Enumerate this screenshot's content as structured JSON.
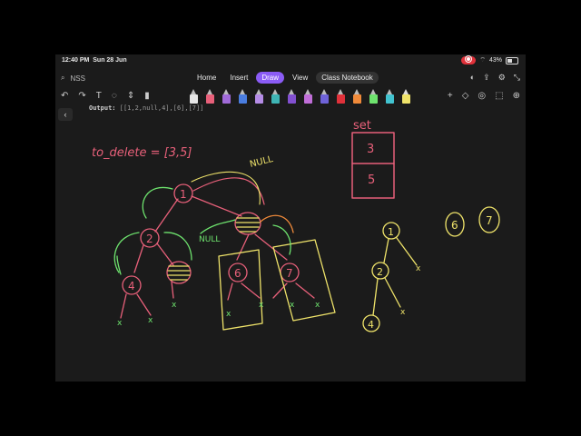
{
  "status": {
    "time": "12:40 PM",
    "date": "Sun 28 Jun",
    "battery": "43%"
  },
  "nav": {
    "notebook_name": "NSS",
    "tabs": [
      {
        "label": "Home"
      },
      {
        "label": "Insert"
      },
      {
        "label": "Draw"
      },
      {
        "label": "View"
      },
      {
        "label": "Class Notebook"
      }
    ]
  },
  "page": {
    "output_label": "Output:",
    "output_value": "[[1,2,null,4],[6],[7]]"
  },
  "drawing": {
    "to_delete": "to_delete = [3,5]",
    "null_1": "NULL",
    "null_2": "NULL",
    "set_label": "set",
    "set_items": [
      "3",
      "5"
    ],
    "nodes_left": [
      "1",
      "2",
      "4",
      "6",
      "7"
    ],
    "nodes_right": [
      "1",
      "2",
      "4"
    ],
    "forest": [
      "6",
      "7"
    ],
    "cross": "x"
  },
  "colors": {
    "accent": "#8b5cf6",
    "pink": "#e8607a",
    "green": "#6ee36e",
    "yellow": "#efe36a",
    "orange": "#f08a3a",
    "record": "#e0313a"
  }
}
